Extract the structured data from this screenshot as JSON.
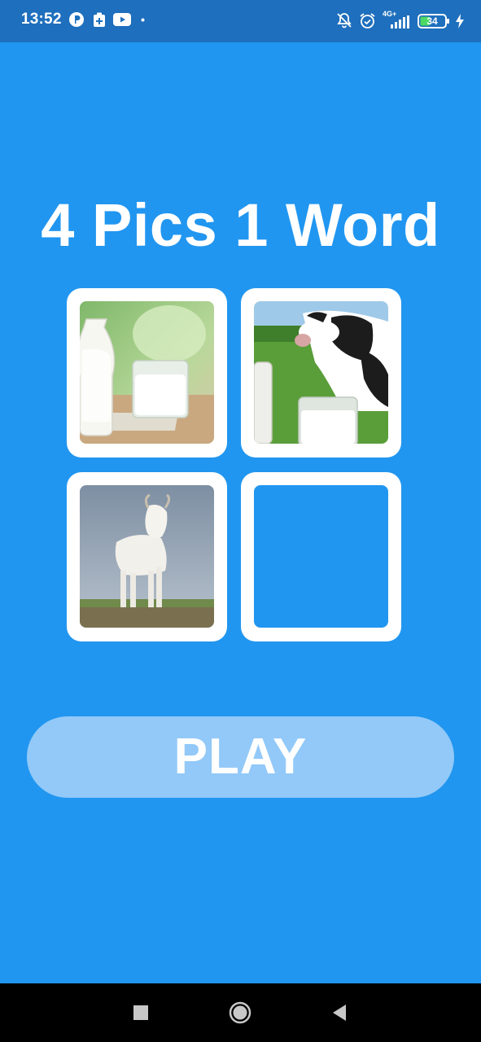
{
  "status_bar": {
    "time": "13:52",
    "battery_level": "34",
    "network_label": "4G+",
    "left_icons": [
      "pinterest-like-app-icon",
      "clipboard-plus-icon",
      "youtube-icon",
      "dot-icon"
    ],
    "right_icons": [
      "bell-off-icon",
      "alarm-icon",
      "signal-icon",
      "battery-icon",
      "charging-bolt-icon"
    ],
    "background_color": "#1e6fbd"
  },
  "main": {
    "title": "4 Pics 1 Word",
    "background_color": "#2196f0",
    "tiles": [
      {
        "picture": "milk-jug-and-glass",
        "empty": false
      },
      {
        "picture": "cow-and-milk",
        "empty": false
      },
      {
        "picture": "white-goat",
        "empty": false
      },
      {
        "picture": "",
        "empty": true
      }
    ],
    "play_button_label": "PLAY",
    "play_button_color": "#92c9f8"
  },
  "nav_bar": {
    "buttons": [
      "recent-apps-square-icon",
      "home-circle-icon",
      "back-triangle-icon"
    ]
  }
}
